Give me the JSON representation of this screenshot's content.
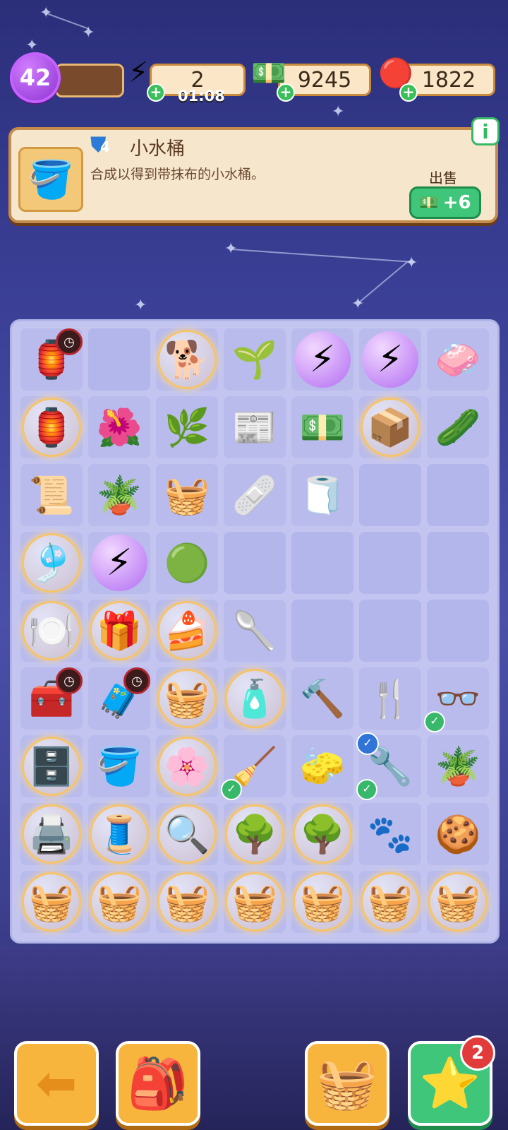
{
  "top_bar": {
    "level": "42",
    "energy": "2",
    "energy_timer": "01:08",
    "cash": "9245",
    "gems": "1822"
  },
  "info_panel": {
    "item_level": "4",
    "item_name": "小水桶",
    "item_desc": "合成以得到带抹布的小水桶。",
    "sell_label": "出售",
    "sell_value": "+6",
    "thumb_icon": "bucket-icon"
  },
  "board": {
    "rows": [
      [
        {
          "icon": "🏮",
          "name": "lantern-generator-icon",
          "clock": true
        },
        {
          "icon": "",
          "name": "empty"
        },
        {
          "icon": "🐕",
          "name": "dog-bubble-icon",
          "bubble": true
        },
        {
          "icon": "🌱",
          "name": "sprout-icon"
        },
        {
          "icon": "⚡",
          "name": "energy-bubble-icon",
          "purple": true
        },
        {
          "icon": "⚡",
          "name": "energy-bubble-icon",
          "purple": true
        },
        {
          "icon": "🧼",
          "name": "soap-icon"
        }
      ],
      [
        {
          "icon": "🏮",
          "name": "lantern-bubble-icon",
          "bubble": true
        },
        {
          "icon": "🌺",
          "name": "flower-bush-icon"
        },
        {
          "icon": "🌿",
          "name": "bush-icon"
        },
        {
          "icon": "📰",
          "name": "newspaper-icon"
        },
        {
          "icon": "💵",
          "name": "cash-pile-icon"
        },
        {
          "icon": "📦",
          "name": "box-bubble-icon",
          "bubble": true
        },
        {
          "icon": "🥒",
          "name": "cucumber-slice-icon"
        }
      ],
      [
        {
          "icon": "📜",
          "name": "papers-icon"
        },
        {
          "icon": "🪴",
          "name": "clay-pot-icon"
        },
        {
          "icon": "🧺",
          "name": "bucket-icon"
        },
        {
          "icon": "🩹",
          "name": "bandage-head-icon"
        },
        {
          "icon": "🧻",
          "name": "bandage-roll-icon"
        },
        {
          "icon": "",
          "name": "empty"
        },
        {
          "icon": "",
          "name": "empty"
        }
      ],
      [
        {
          "icon": "🎐",
          "name": "trinket-bubble-icon",
          "bubble": true
        },
        {
          "icon": "⚡",
          "name": "energy-bubble-icon",
          "purple": true
        },
        {
          "icon": "🟢",
          "name": "green-ball-icon"
        },
        {
          "icon": "",
          "name": "empty"
        },
        {
          "icon": "",
          "name": "empty"
        },
        {
          "icon": "",
          "name": "empty"
        },
        {
          "icon": "",
          "name": "empty"
        }
      ],
      [
        {
          "icon": "🍽️",
          "name": "dishes-bubble-icon",
          "bubble": true
        },
        {
          "icon": "🎁",
          "name": "gift-bubble-icon",
          "bubble": true
        },
        {
          "icon": "🍰",
          "name": "cake-bubble-icon",
          "bubble": true
        },
        {
          "icon": "🥄",
          "name": "trowel-icon"
        },
        {
          "icon": "",
          "name": "empty"
        },
        {
          "icon": "",
          "name": "empty"
        },
        {
          "icon": "",
          "name": "empty"
        }
      ],
      [
        {
          "icon": "🧰",
          "name": "cart-generator-icon",
          "clock": true
        },
        {
          "icon": "🧳",
          "name": "toolbox-generator-icon",
          "clock": true
        },
        {
          "icon": "🧺",
          "name": "basket-bubble-icon",
          "bubble": true
        },
        {
          "icon": "🧴",
          "name": "bottle-bubble-icon",
          "bubble": true
        },
        {
          "icon": "🔨",
          "name": "hand-trowel-icon"
        },
        {
          "icon": "🍴",
          "name": "garden-fork-icon"
        },
        {
          "icon": "👓",
          "name": "glasses-icon",
          "check": true
        }
      ],
      [
        {
          "icon": "🗄️",
          "name": "cabinet-bubble-icon",
          "bubble": true
        },
        {
          "icon": "🪣",
          "name": "bucket-icon"
        },
        {
          "icon": "🌸",
          "name": "blossom-tree-bubble-icon",
          "bubble": true
        },
        {
          "icon": "🧹",
          "name": "broom-icon",
          "check": true
        },
        {
          "icon": "🧽",
          "name": "mop-icon"
        },
        {
          "icon": "🔧",
          "name": "tool-icon",
          "check": true,
          "blue": true
        },
        {
          "icon": "🪴",
          "name": "potted-plant-icon"
        }
      ],
      [
        {
          "icon": "🖨️",
          "name": "printer-bubble-icon",
          "bubble": true
        },
        {
          "icon": "🧵",
          "name": "craft-bubble-icon",
          "bubble": true
        },
        {
          "icon": "🔍",
          "name": "map-bubble-icon",
          "bubble": true
        },
        {
          "icon": "🌳",
          "name": "planter-bubble-icon",
          "bubble": true
        },
        {
          "icon": "🌳",
          "name": "planter-bubble-icon",
          "bubble": true
        },
        {
          "icon": "🐾",
          "name": "paw-tray-icon"
        },
        {
          "icon": "🍪",
          "name": "cookies-icon"
        }
      ],
      [
        {
          "icon": "🧺",
          "name": "laundry-bubble-icon",
          "bubble": true
        },
        {
          "icon": "🧺",
          "name": "laundry-bubble-icon",
          "bubble": true
        },
        {
          "icon": "🧺",
          "name": "laundry-bubble-icon",
          "bubble": true
        },
        {
          "icon": "🧺",
          "name": "laundry-bubble-icon",
          "bubble": true
        },
        {
          "icon": "🧺",
          "name": "laundry-bubble-icon",
          "bubble": true
        },
        {
          "icon": "🧺",
          "name": "laundry-bubble-icon",
          "bubble": true
        },
        {
          "icon": "🧺",
          "name": "laundry-bubble-icon",
          "bubble": true
        }
      ]
    ]
  },
  "bottom": {
    "back_icon": "arrow-left-icon",
    "backpack_icon": "backpack-icon",
    "shop_icon": "basket-icon",
    "star_icon": "star-icon",
    "star_badge": "2"
  }
}
